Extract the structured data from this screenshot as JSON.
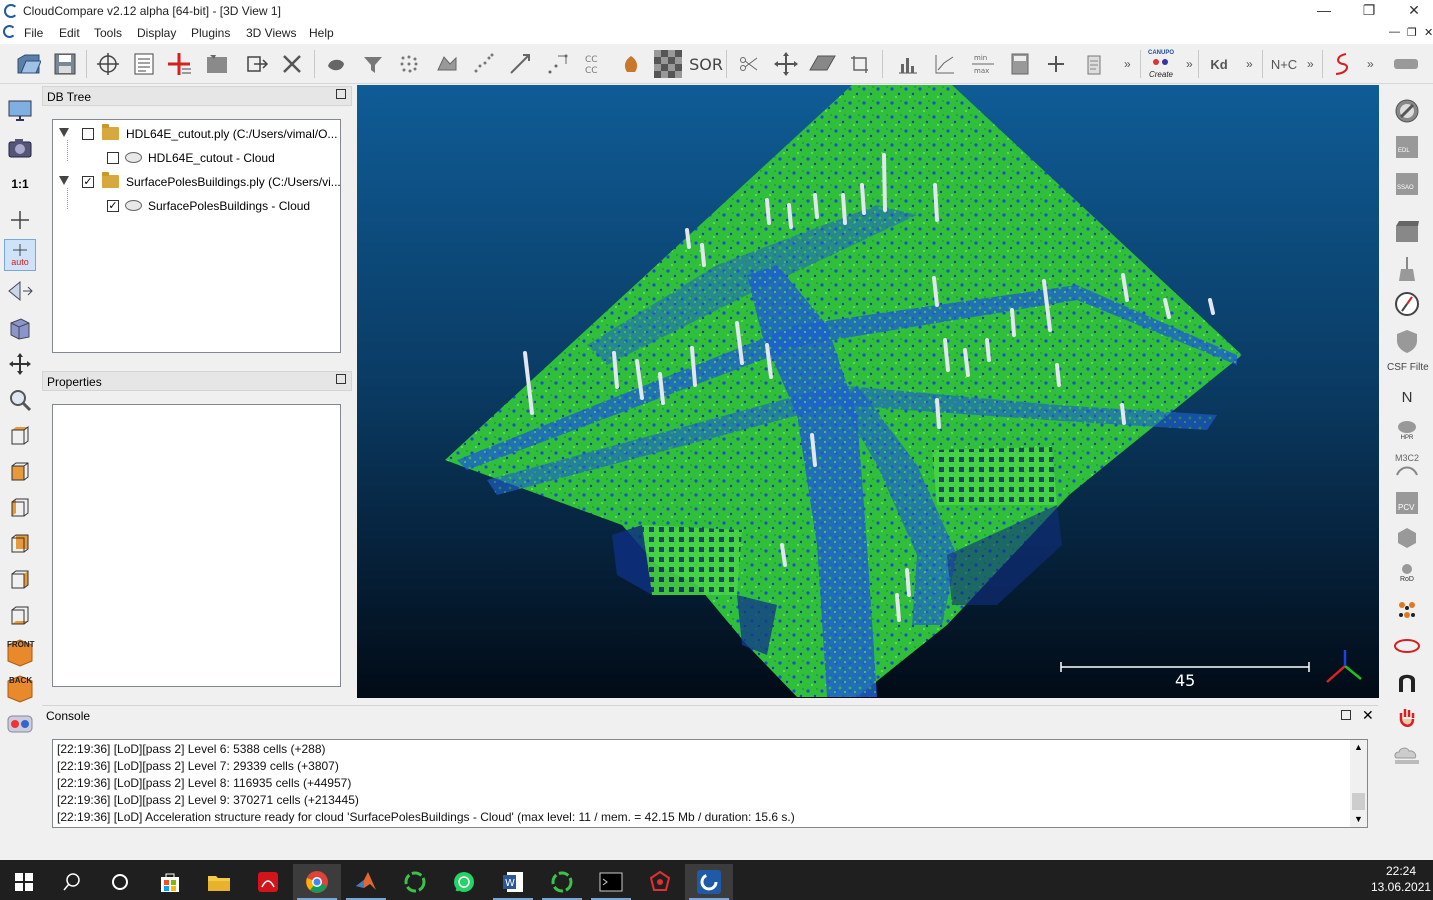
{
  "window": {
    "title": "CloudCompare v2.12 alpha [64-bit] - [3D View 1]"
  },
  "menu": [
    "File",
    "Edit",
    "Tools",
    "Display",
    "Plugins",
    "3D Views",
    "Help"
  ],
  "toolbar": {
    "canupo_top": "CANUPO",
    "canupo_bottom": "Create",
    "sor_label": "SOR",
    "kd_label": "Kd",
    "ntc_label": "N+C"
  },
  "leftbar": {
    "one_to_one": "1:1",
    "auto_label": "auto",
    "front_label": "FRONT",
    "back_label": "BACK"
  },
  "db_tree": {
    "title": "DB Tree",
    "items": [
      {
        "label": "HDL64E_cutout.ply (C:/Users/vimal/O...",
        "checked": ""
      },
      {
        "label": "HDL64E_cutout - Cloud",
        "checked": ""
      },
      {
        "label": "SurfacePolesBuildings.ply (C:/Users/vi...",
        "checked": "✓"
      },
      {
        "label": "SurfacePolesBuildings - Cloud",
        "checked": "✓"
      }
    ]
  },
  "properties": {
    "title": "Properties"
  },
  "view3d": {
    "scale_value": "45"
  },
  "rightbar": {
    "csf_label": "CSF Filte",
    "north_label": "N",
    "m3c2_label": "M3C2",
    "pcv_label": "PCV",
    "rod_label": "RoD",
    "hpr_label": "HPR",
    "edl_label": "EDL",
    "ssao_label": "SSAO"
  },
  "console": {
    "title": "Console",
    "lines": [
      "[22:19:36] [LoD][pass 2] Level 6: 5388 cells (+288)",
      "[22:19:36] [LoD][pass 2] Level 7: 29339 cells (+3807)",
      "[22:19:36] [LoD][pass 2] Level 8: 116935 cells (+44957)",
      "[22:19:36] [LoD][pass 2] Level 9: 370271 cells (+213445)",
      "[22:19:36] [LoD] Acceleration structure ready for cloud 'SurfacePolesBuildings - Cloud' (max level: 11 / mem. = 42.15 Mb / duration: 15.6 s.)"
    ]
  },
  "taskbar": {
    "time": "22:24",
    "date": "13.06.2021"
  }
}
